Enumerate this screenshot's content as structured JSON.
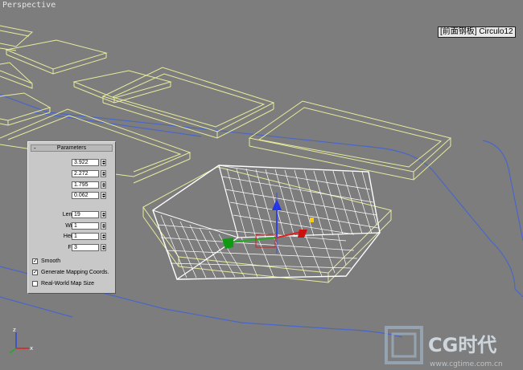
{
  "viewport": {
    "label": "Perspective",
    "object_tag": "[前面钢板] Circulo12"
  },
  "colors": {
    "background": "#7d7d7d",
    "yellow_wire": "#e8ec9c",
    "white_wire": "#ffffff",
    "blue_line": "#4a66c8"
  },
  "parameters_panel": {
    "title": "Parameters",
    "fields": [
      {
        "label": "Length:",
        "value": "3.922"
      },
      {
        "label": "Width:",
        "value": "2.272"
      },
      {
        "label": "Height:",
        "value": "1.795"
      },
      {
        "label": "Fillet:",
        "value": "0.062"
      },
      {
        "label": "Length Segs:",
        "value": "19"
      },
      {
        "label": "Width Segs:",
        "value": "1"
      },
      {
        "label": "Height Segs:",
        "value": "1"
      },
      {
        "label": "Fillet Segs:",
        "value": "3"
      }
    ],
    "checkboxes": [
      {
        "label": "Smooth",
        "checked": true
      },
      {
        "label": "Generate Mapping Coords.",
        "checked": true
      },
      {
        "label": "Real-World Map Size",
        "checked": false
      }
    ]
  },
  "watermark": {
    "text": "CG时代",
    "url": "www.cgtime.com.cn"
  }
}
